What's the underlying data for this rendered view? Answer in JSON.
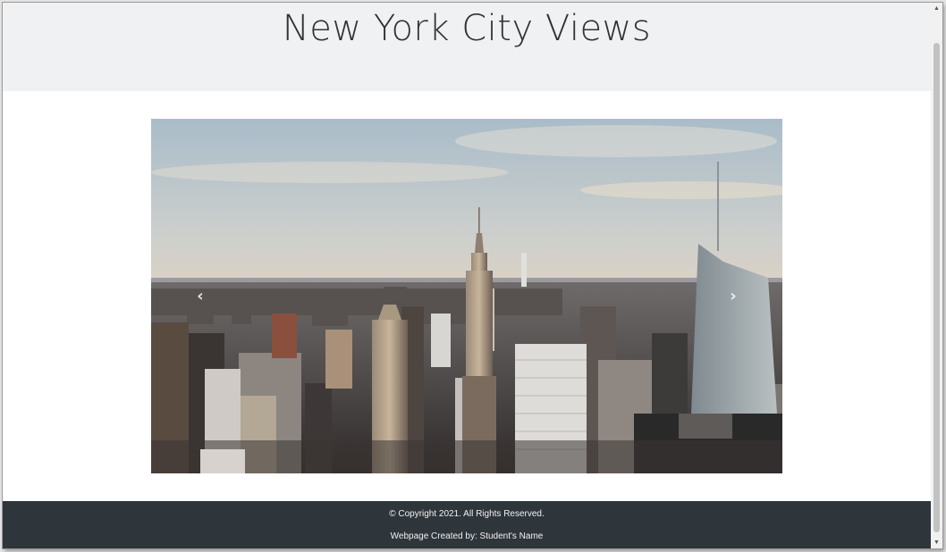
{
  "header": {
    "title": "New York City Views"
  },
  "carousel": {
    "image_description": "New York City skyline at sunset with Empire State Building",
    "prev_icon": "chevron-left-icon",
    "next_icon": "chevron-right-icon",
    "prev_glyph": "‹",
    "next_glyph": "›"
  },
  "footer": {
    "copyright": "© Copyright 2021. All Rights Reserved.",
    "credit": "Webpage Created by: Student's Name"
  },
  "colors": {
    "header_bg": "#f0f1f2",
    "footer_bg": "#2e353b",
    "page_bg": "#ffffff"
  },
  "scrollbar": {
    "up_glyph": "▲",
    "down_glyph": "▼"
  }
}
